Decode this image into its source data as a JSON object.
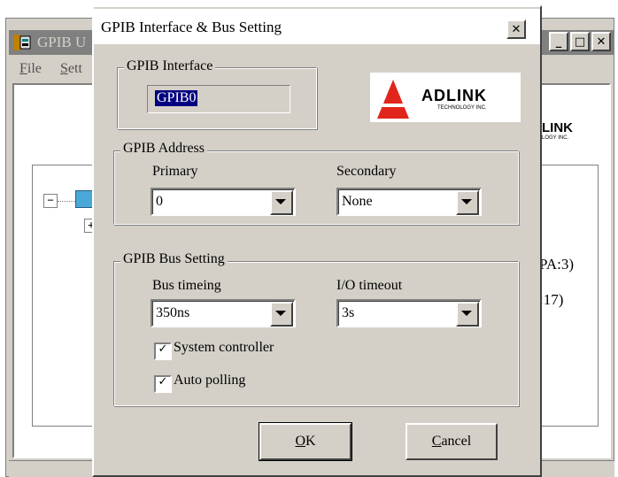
{
  "main_window": {
    "title": "GPIB U",
    "menu": {
      "file_mnemonic": "F",
      "file_rest": "ile",
      "settings_mnemonic": "S",
      "settings_rest": "ett"
    },
    "tree_fragments": {
      "item1": "PA:3)",
      "item2": ":17)"
    },
    "logo_fragment": {
      "text": "LINK",
      "sub": "LOGY INC."
    }
  },
  "dialog": {
    "title": "GPIB Interface & Bus Setting",
    "interface_group": {
      "legend": "GPIB Interface",
      "value": "GPIB0"
    },
    "logo": {
      "name": "ADLINK",
      "tagline": "TECHNOLOGY INC.",
      "color": "#e1251b"
    },
    "address_group": {
      "legend": "GPIB Address",
      "primary_label": "Primary",
      "primary_value": "0",
      "secondary_label": "Secondary",
      "secondary_value": "None"
    },
    "bus_group": {
      "legend": "GPIB Bus Setting",
      "timing_label": "Bus timeing",
      "timing_value": "350ns",
      "timeout_label": "I/O timeout",
      "timeout_value": "3s",
      "system_controller": {
        "label": "System controller",
        "checked": true
      },
      "auto_polling": {
        "label": "Auto polling",
        "checked": true
      }
    },
    "ok": {
      "mnemonic": "O",
      "rest": "K"
    },
    "cancel": {
      "mnemonic": "C",
      "rest": "ancel"
    }
  }
}
